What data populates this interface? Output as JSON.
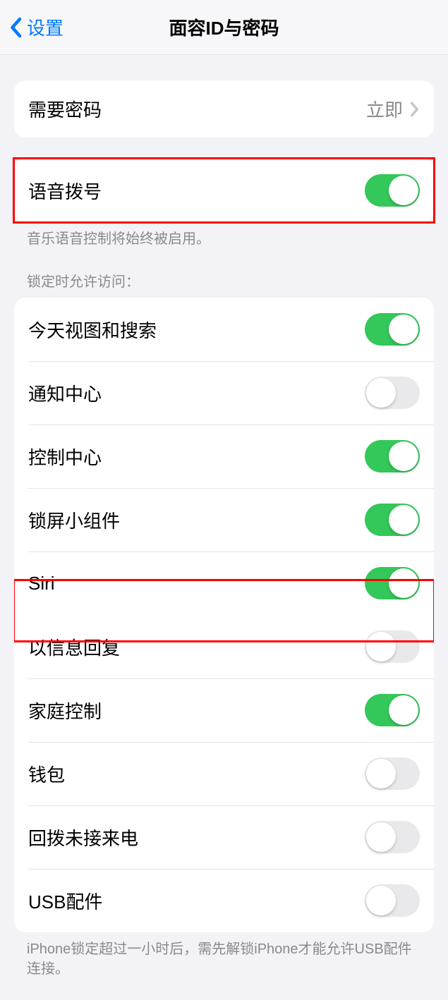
{
  "header": {
    "back_label": "设置",
    "title": "面容ID与密码"
  },
  "require_passcode": {
    "label": "需要密码",
    "value": "立即"
  },
  "voice_dial": {
    "label": "语音拨号",
    "enabled": true,
    "footer": "音乐语音控制将始终被启用。"
  },
  "lock_access": {
    "header": "锁定时允许访问：",
    "items": [
      {
        "label": "今天视图和搜索",
        "enabled": true
      },
      {
        "label": "通知中心",
        "enabled": false
      },
      {
        "label": "控制中心",
        "enabled": true
      },
      {
        "label": "锁屏小组件",
        "enabled": true
      },
      {
        "label": "Siri",
        "enabled": true
      },
      {
        "label": "以信息回复",
        "enabled": false
      },
      {
        "label": "家庭控制",
        "enabled": true
      },
      {
        "label": "钱包",
        "enabled": false
      },
      {
        "label": "回拨未接来电",
        "enabled": false
      },
      {
        "label": "USB配件",
        "enabled": false
      }
    ],
    "footer": "iPhone锁定超过一小时后，需先解锁iPhone才能允许USB配件连接。"
  },
  "highlights": {
    "voice_dial": true,
    "siri_index": 4
  }
}
